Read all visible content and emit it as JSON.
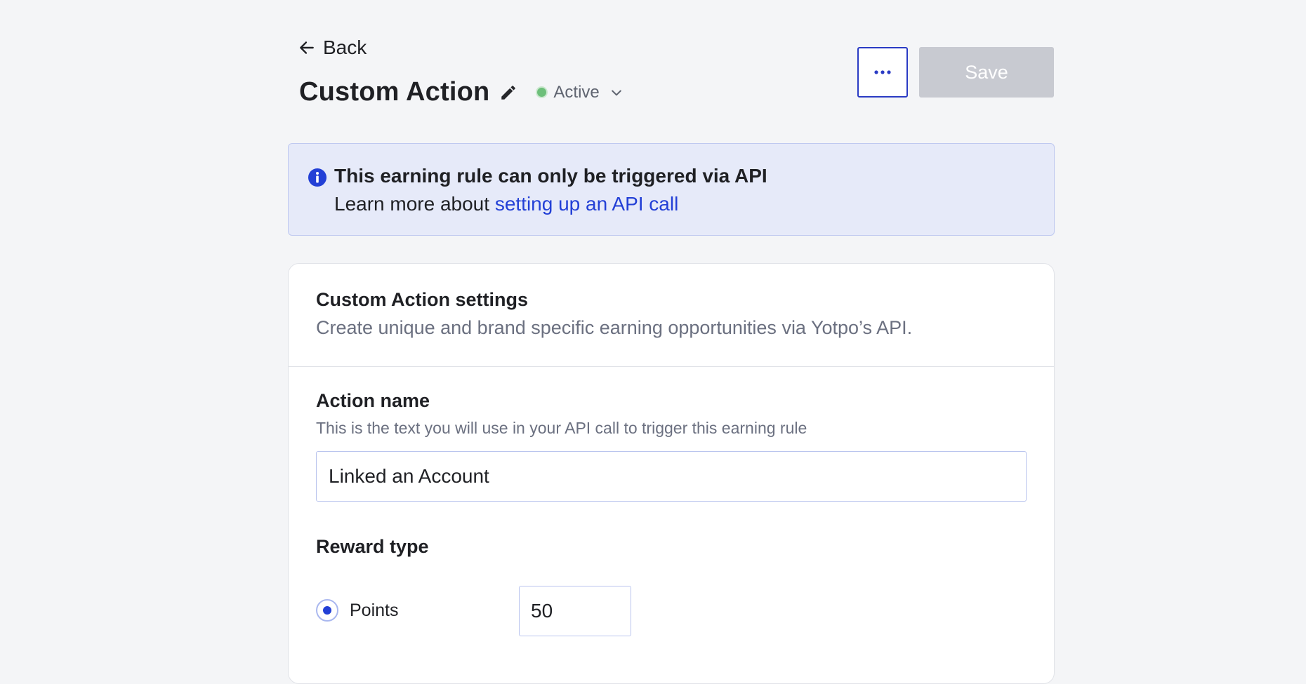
{
  "header": {
    "back_label": "Back",
    "title": "Custom Action",
    "status": "Active",
    "save_label": "Save",
    "more_label": "···"
  },
  "banner": {
    "title": "This earning rule can only be triggered via API",
    "text_prefix": "Learn more about ",
    "link_text": "setting up an API call"
  },
  "settings": {
    "title": "Custom Action settings",
    "subtitle": "Create unique and brand specific earning opportunities via Yotpo’s API.",
    "action_name": {
      "label": "Action name",
      "help": "This is the text you will use in your API call to trigger this earning rule",
      "value": "Linked an Account"
    },
    "reward_type": {
      "label": "Reward type",
      "option_label": "Points",
      "points_value": "50"
    }
  },
  "colors": {
    "accent": "#2340d6",
    "status_active": "#6dbf7a",
    "banner_bg": "#e6eaf9",
    "save_disabled": "#c8cad1"
  },
  "icons": {
    "back": "arrow-left-icon",
    "edit": "pencil-icon",
    "status_dropdown": "chevron-down-icon",
    "more": "ellipsis-icon",
    "info": "info-icon"
  }
}
